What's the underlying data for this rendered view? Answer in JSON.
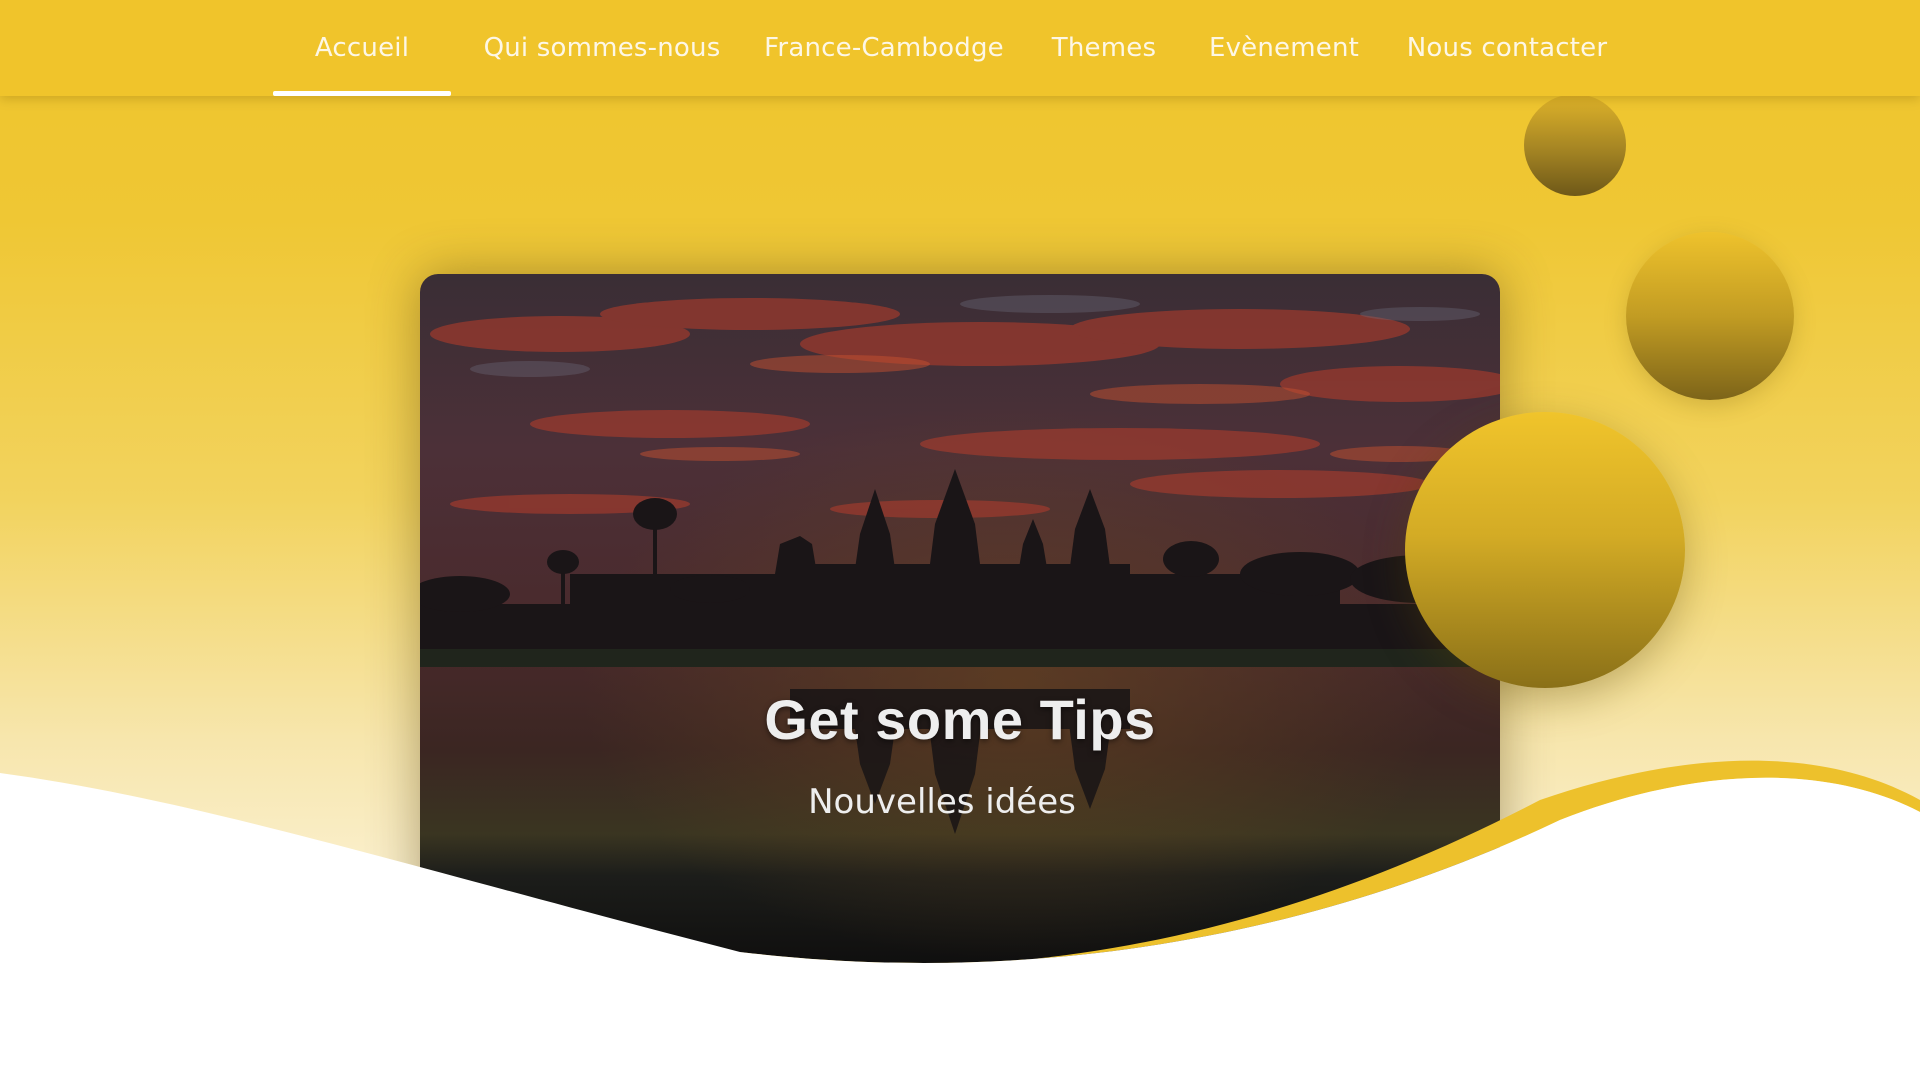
{
  "nav": {
    "items": [
      {
        "label": "Accueil",
        "active": true
      },
      {
        "label": "Qui sommes-nous",
        "active": false
      },
      {
        "label": "France-Cambodge",
        "active": false
      },
      {
        "label": "Themes",
        "active": false
      },
      {
        "label": "Evènement",
        "active": false
      },
      {
        "label": "Nous contacter",
        "active": false
      }
    ]
  },
  "hero": {
    "image": "sunset-temple-silhouette",
    "title": "Get some Tips",
    "subtitle": "Nouvelles idées"
  },
  "colors": {
    "brand_yellow": "#f0c42b",
    "nav_text": "#fdf7e6",
    "bubble_dark": "#7d6419",
    "wave_accent": "#edc12c"
  }
}
